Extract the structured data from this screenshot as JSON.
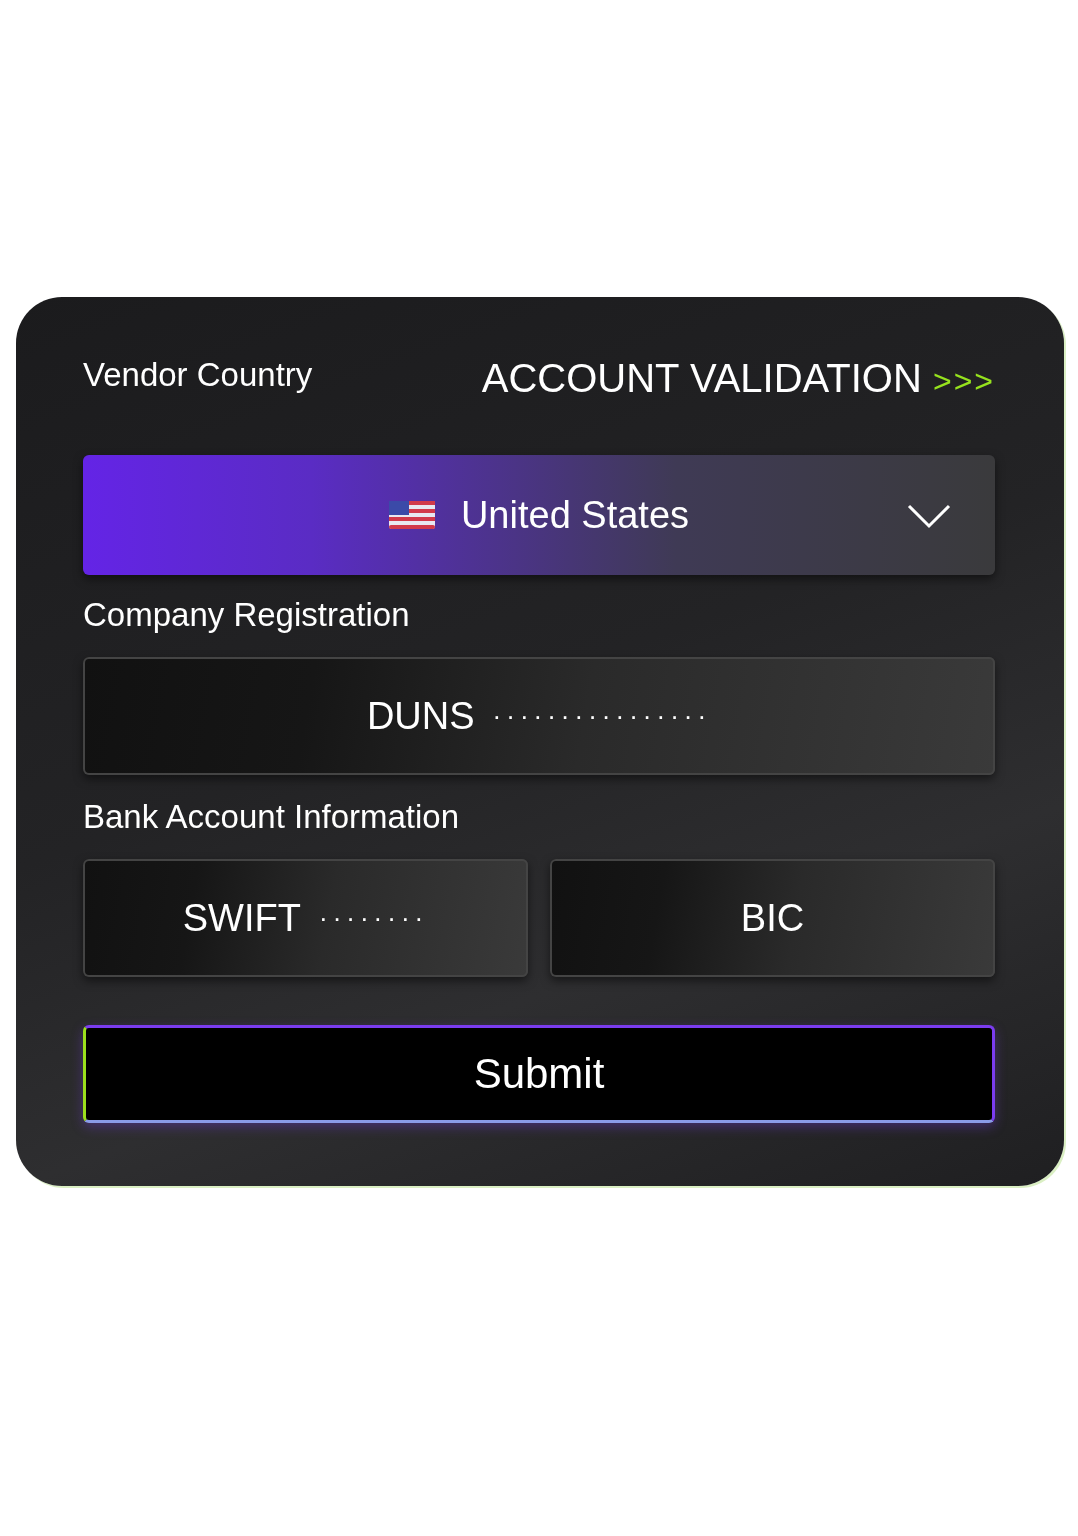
{
  "header": {
    "title": "ACCOUNT VALIDATION",
    "arrows": ">>>"
  },
  "vendor_country": {
    "label": "Vendor Country",
    "value": "United States"
  },
  "company_registration": {
    "label": "Company Registration",
    "inputs": [
      {
        "name": "DUNS",
        "value": "················"
      }
    ]
  },
  "bank_account": {
    "label": "Bank Account Information",
    "inputs": [
      {
        "name": "SWIFT",
        "value": "········"
      },
      {
        "name": "BIC"
      }
    ]
  },
  "submit": "Submit"
}
